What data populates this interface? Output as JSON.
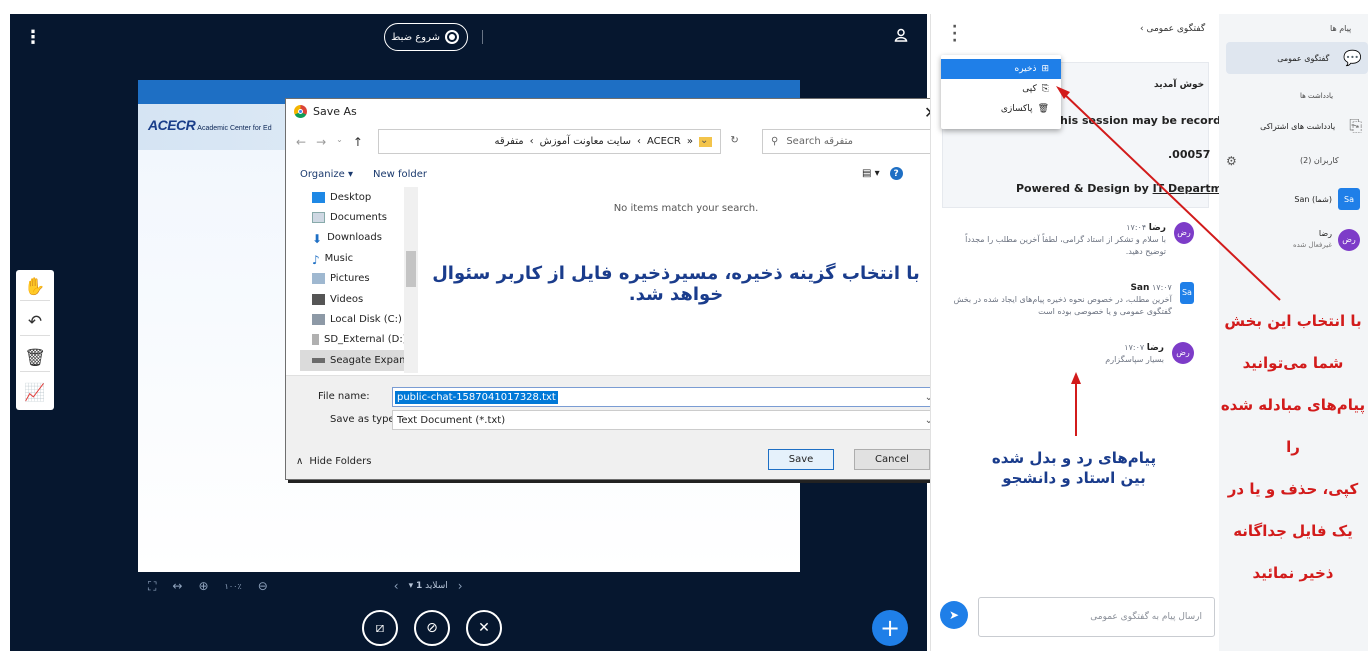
{
  "toolbar": {
    "record_label": "شروع ضبط"
  },
  "slide": {
    "logo_brand": "ACECR",
    "logo_text": "Academic Center for Ed",
    "page_label": "اسلاید",
    "page_number": "1",
    "zoom": "۱۰۰٪"
  },
  "dialog": {
    "title": "Save As",
    "address": [
      "ACECR",
      "سایت معاونت آموزش",
      "متفرقه"
    ],
    "address_prefix": "«",
    "search_placeholder": "Search متفرقه",
    "organize": "Organize ▾",
    "new_folder": "New folder",
    "tree": [
      "Desktop",
      "Documents",
      "Downloads",
      "Music",
      "Pictures",
      "Videos",
      "Local Disk (C:)",
      "SD_External (D:)",
      "Seagate Expansi"
    ],
    "empty_message": "No items match your search.",
    "annotation": "با انتخاب گزینه ذخیره، مسیرذخیره فایل از کاربر سئوال خواهد شد.",
    "file_name_label": "File name:",
    "file_name_value": "public-chat-1587041017328.txt",
    "save_type_label": "Save as type:",
    "save_type_value": "Text Document (*.txt)",
    "hide_folders": "Hide Folders",
    "save_button": "Save",
    "cancel_button": "Cancel"
  },
  "chat": {
    "title": "گفتگوی عمومی",
    "menu": [
      "ذخیره",
      "کپی",
      "پاکسازی"
    ],
    "welcome_title": "خوش آمدید",
    "welcome_recorded": "This session may be recorded",
    "welcome_recorded_visible": "his session may be recorded",
    "welcome_code": ".00057",
    "welcome_powered": "Powered & Design by ",
    "welcome_powered_link": "IT Department",
    "messages": [
      {
        "name": "رضا",
        "time": "۱۷:۰۴",
        "avatar": "رض",
        "text": "با سلام و تشکر از استاد گرامی، لطفاً آخرین مطلب را مجدداً توضیح دهید."
      },
      {
        "name": "San",
        "time": "۱۷:۰۷",
        "avatar": "Sa",
        "text": "آخرین مطلب، در خصوص نحوه ذخیره پیام‌های ایجاد شده در بخش گفتگوی عمومی و یا خصوصی بوده است"
      },
      {
        "name": "رضا",
        "time": "۱۷:۰۷",
        "avatar": "رض",
        "text": "بسیار سپاسگزارم"
      }
    ],
    "annotation_line1": "پیام‌های رد و بدل شده",
    "annotation_line2": "بین استاد و دانشجو",
    "input_placeholder": "ارسال پیام به گفتگوی عمومی"
  },
  "users": {
    "messages_header": "پیام ها",
    "public_chat": "گفتگوی عمومی",
    "notes_header": "یادداشت ها",
    "shared_notes": "یادداشت های اشتراکی",
    "users_header": "کاربران (2)",
    "user1": "San (شما)",
    "user1_avatar": "Sa",
    "user2": "رضا",
    "user2_status": "غیرفعال شده",
    "user2_avatar": "رض",
    "annotation": [
      "با انتخاب این بخش",
      "شما می‌توانید",
      "پیام‌های مبادله شده را",
      "کپی، حذف و یا در",
      "یک فایل جداگانه",
      "ذخیر نمائید"
    ]
  },
  "colors": {
    "stage": "#06172f",
    "accent": "#1f7fe8",
    "annotation_blue": "#1a3c8c",
    "annotation_red": "#d21b1b"
  }
}
